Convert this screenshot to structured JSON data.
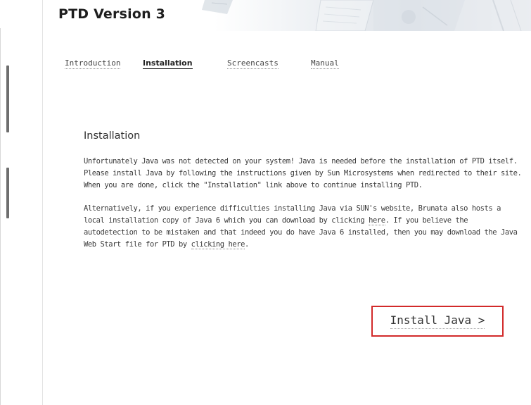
{
  "header": {
    "title": "PTD Version 3"
  },
  "nav": {
    "items": [
      {
        "label": "Introduction"
      },
      {
        "label": "Installation"
      },
      {
        "label": "Screencasts"
      },
      {
        "label": "Manual"
      }
    ],
    "active": "Installation"
  },
  "main": {
    "heading": "Installation",
    "para1": "Unfortunately Java was not detected on your system! Java is needed before the installation of PTD itself. Please install Java by following the instructions given by Sun Microsystems when redirected to their site. When you are done, click the \"Installation\" link above to continue installing PTD.",
    "para2_part1": "Alternatively, if you experience difficulties installing Java via SUN's website, Brunata also hosts a local installation copy of Java 6 which you can download by clicking ",
    "para2_link1": "here",
    "para2_part2": ". If you believe the autodetection to be mistaken and that indeed you do have Java 6 installed, then you may download the Java Web Start file for PTD by ",
    "para2_link2": "clicking here",
    "para2_part3": ".",
    "install_button": "Install Java >"
  },
  "colors": {
    "highlight_border": "#d22a2a"
  }
}
